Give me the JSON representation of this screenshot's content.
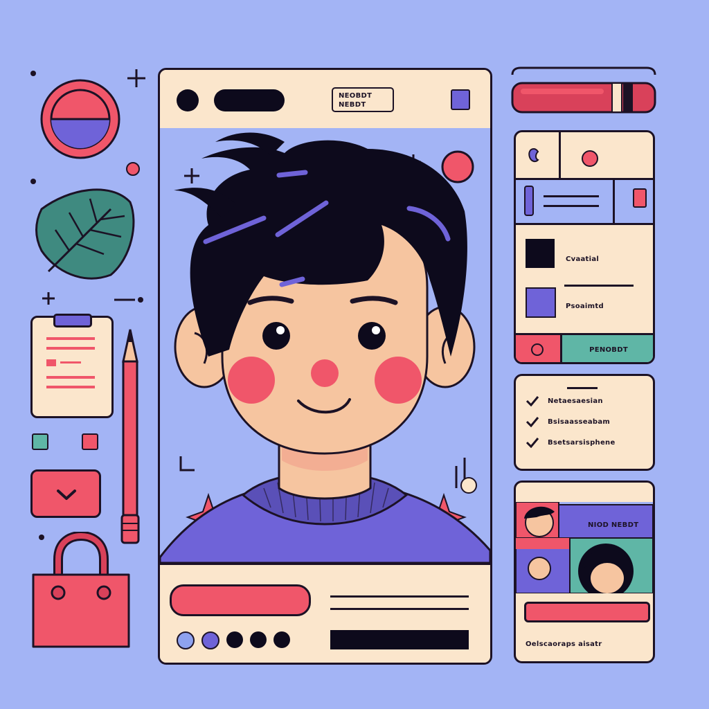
{
  "colors": {
    "background": "#a3b4f5",
    "panel": "#fbe6cc",
    "outline": "#1c1225",
    "accent_red": "#f0566a",
    "accent_purple": "#6f63d8",
    "accent_teal": "#5fb6a6",
    "skin": "#f6c5a0",
    "hair": "#0d0a1c"
  },
  "main_card": {
    "header_tag": [
      "NEOBDT",
      "NEBDT"
    ],
    "dot_controls": [
      "purple-dot",
      "purple-dot",
      "black-dot",
      "black-dot",
      "black-dot"
    ]
  },
  "side_panel": {
    "row1_label": "Cvaatial",
    "row2_label": "Psoaimtd",
    "footer_button": "PENOBDT"
  },
  "checklist": {
    "items": [
      "Netaesaesian",
      "Bsisaasseabam",
      "Bsetsarsisphene"
    ]
  },
  "profile_card": {
    "banner_text": "NIOD NEBDT",
    "caption": "Oelscaoraps aisatr"
  },
  "icons": [
    "plus-icon",
    "leaf-icon",
    "clipboard-icon",
    "pencil-icon",
    "chevron-down-icon",
    "bag-icon",
    "checkmark-icon",
    "sparkle-icon"
  ]
}
